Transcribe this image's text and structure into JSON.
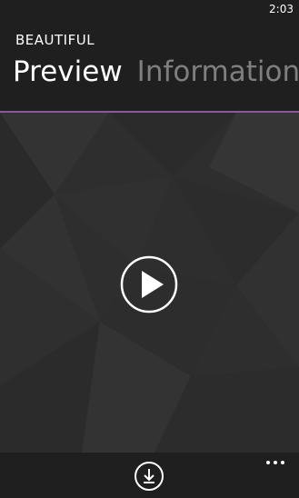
{
  "status_bar": {
    "time": "2:03"
  },
  "header": {
    "app_title": "BEAUTIFUL",
    "tabs": [
      {
        "label": "Preview",
        "active": true
      },
      {
        "label": "Information",
        "active": false
      }
    ]
  },
  "colors": {
    "background": "#1f1f1f",
    "preview_background": "#2f2f2f",
    "accent": "#8b5a9c",
    "inactive_tab": "#7f7f7f"
  },
  "preview": {
    "play_icon": "play-icon"
  },
  "app_bar": {
    "download_icon": "download-icon",
    "more_icon": "more-dots-icon"
  }
}
